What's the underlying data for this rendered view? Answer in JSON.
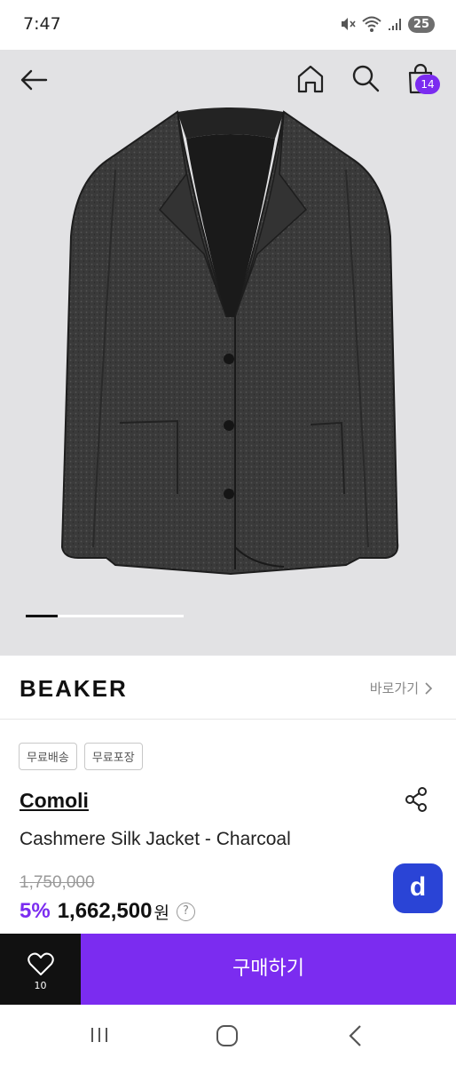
{
  "status_bar": {
    "time": "7:47",
    "battery": "25"
  },
  "header": {
    "icons": [
      "back-arrow-icon",
      "home-icon",
      "search-icon",
      "shopping-bag-icon"
    ],
    "cart_count": "14"
  },
  "gallery": {
    "image": "charcoal-jacket-photo",
    "progress": 0.2
  },
  "brand": {
    "logo": "BEAKER",
    "link_label": "바로가기"
  },
  "tags": [
    "무료배송",
    "무료포장"
  ],
  "product": {
    "designer": "Comoli",
    "name": "Cashmere Silk Jacket - Charcoal",
    "original_price": "1,750,000",
    "discount": "5%",
    "final_price": "1,662,500",
    "currency": "원",
    "help_symbol": "?"
  },
  "floating_button": {
    "label": "d",
    "color": "#2a44d6"
  },
  "bottom_bar": {
    "like_count": "10",
    "buy_label": "구매하기",
    "accent_color": "#7b2cf0"
  },
  "system_nav": [
    "recents-icon",
    "home-circle-icon",
    "back-chevron-icon"
  ]
}
